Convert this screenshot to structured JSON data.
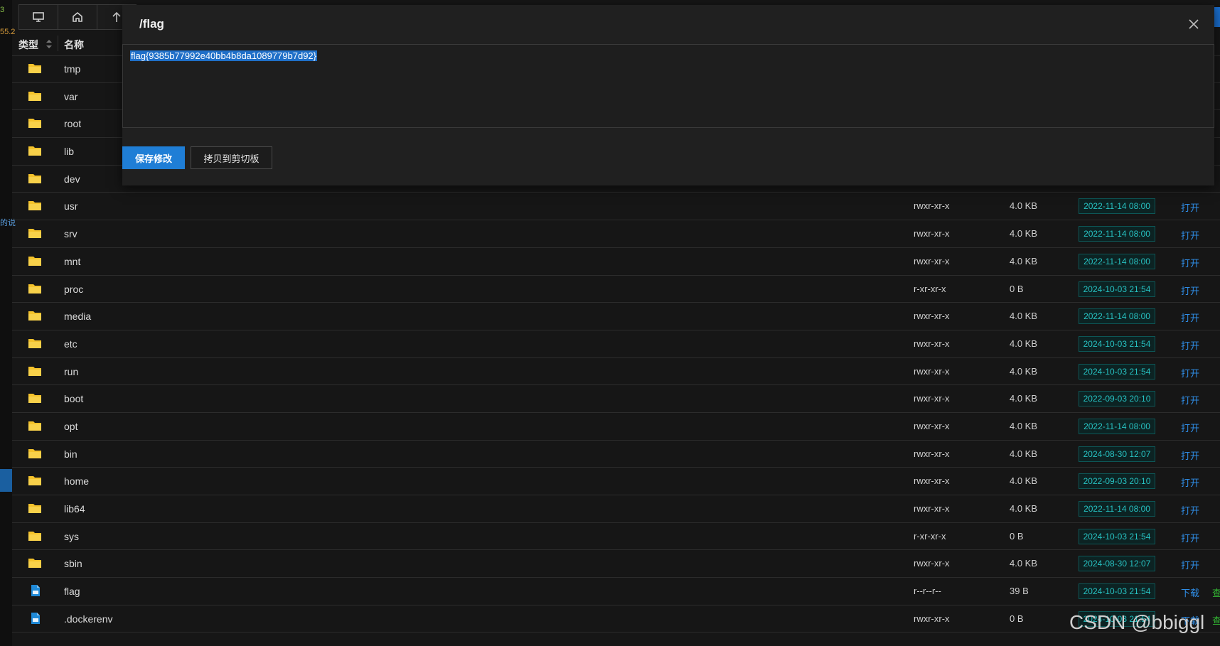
{
  "left_strip": {
    "tag_top": "3",
    "tag_mid": "55.2",
    "tag_low": "的说"
  },
  "toolbar": [
    {
      "icon": "monitor-icon"
    },
    {
      "icon": "home-icon"
    },
    {
      "icon": "arrow-up-icon"
    }
  ],
  "header": {
    "type": "类型",
    "name": "名称"
  },
  "files": [
    {
      "kind": "folder",
      "name": "tmp",
      "perm": "",
      "size": "",
      "date": "",
      "action": ""
    },
    {
      "kind": "folder",
      "name": "var",
      "perm": "",
      "size": "",
      "date": "",
      "action": ""
    },
    {
      "kind": "folder",
      "name": "root",
      "perm": "",
      "size": "",
      "date": "",
      "action": ""
    },
    {
      "kind": "folder",
      "name": "lib",
      "perm": "",
      "size": "",
      "date": "",
      "action": ""
    },
    {
      "kind": "folder",
      "name": "dev",
      "perm": "",
      "size": "",
      "date": "",
      "action": ""
    },
    {
      "kind": "folder",
      "name": "usr",
      "perm": "rwxr-xr-x",
      "size": "4.0 KB",
      "date": "2022-11-14 08:00",
      "action": "打开"
    },
    {
      "kind": "folder",
      "name": "srv",
      "perm": "rwxr-xr-x",
      "size": "4.0 KB",
      "date": "2022-11-14 08:00",
      "action": "打开"
    },
    {
      "kind": "folder",
      "name": "mnt",
      "perm": "rwxr-xr-x",
      "size": "4.0 KB",
      "date": "2022-11-14 08:00",
      "action": "打开"
    },
    {
      "kind": "folder",
      "name": "proc",
      "perm": "r-xr-xr-x",
      "size": "0 B",
      "date": "2024-10-03 21:54",
      "action": "打开"
    },
    {
      "kind": "folder",
      "name": "media",
      "perm": "rwxr-xr-x",
      "size": "4.0 KB",
      "date": "2022-11-14 08:00",
      "action": "打开"
    },
    {
      "kind": "folder",
      "name": "etc",
      "perm": "rwxr-xr-x",
      "size": "4.0 KB",
      "date": "2024-10-03 21:54",
      "action": "打开"
    },
    {
      "kind": "folder",
      "name": "run",
      "perm": "rwxr-xr-x",
      "size": "4.0 KB",
      "date": "2024-10-03 21:54",
      "action": "打开"
    },
    {
      "kind": "folder",
      "name": "boot",
      "perm": "rwxr-xr-x",
      "size": "4.0 KB",
      "date": "2022-09-03 20:10",
      "action": "打开"
    },
    {
      "kind": "folder",
      "name": "opt",
      "perm": "rwxr-xr-x",
      "size": "4.0 KB",
      "date": "2022-11-14 08:00",
      "action": "打开"
    },
    {
      "kind": "folder",
      "name": "bin",
      "perm": "rwxr-xr-x",
      "size": "4.0 KB",
      "date": "2024-08-30 12:07",
      "action": "打开"
    },
    {
      "kind": "folder",
      "name": "home",
      "perm": "rwxr-xr-x",
      "size": "4.0 KB",
      "date": "2022-09-03 20:10",
      "action": "打开"
    },
    {
      "kind": "folder",
      "name": "lib64",
      "perm": "rwxr-xr-x",
      "size": "4.0 KB",
      "date": "2022-11-14 08:00",
      "action": "打开"
    },
    {
      "kind": "folder",
      "name": "sys",
      "perm": "r-xr-xr-x",
      "size": "0 B",
      "date": "2024-10-03 21:54",
      "action": "打开"
    },
    {
      "kind": "folder",
      "name": "sbin",
      "perm": "rwxr-xr-x",
      "size": "4.0 KB",
      "date": "2024-08-30 12:07",
      "action": "打开"
    },
    {
      "kind": "file",
      "name": "flag",
      "perm": "r--r--r--",
      "size": "39 B",
      "date": "2024-10-03 21:54",
      "action": "下载",
      "action2": "查"
    },
    {
      "kind": "file",
      "name": ".dockerenv",
      "perm": "rwxr-xr-x",
      "size": "0 B",
      "date": "2024-10-03 21:54",
      "action": "下载",
      "action2": "查"
    }
  ],
  "dialog": {
    "title": "/flag",
    "content": "flag{9385b77992e40bb4b8da1089779b7d92}",
    "save_label": "保存修改",
    "copy_label": "拷贝到剪切板"
  },
  "watermark": "CSDN @bbiggl",
  "colors": {
    "accent": "#1f7ed6",
    "folder": "#f4c22b",
    "file": "#1f8ad8",
    "date_text": "#27c2c2",
    "link": "#2f8de6",
    "link2": "#33b833"
  }
}
